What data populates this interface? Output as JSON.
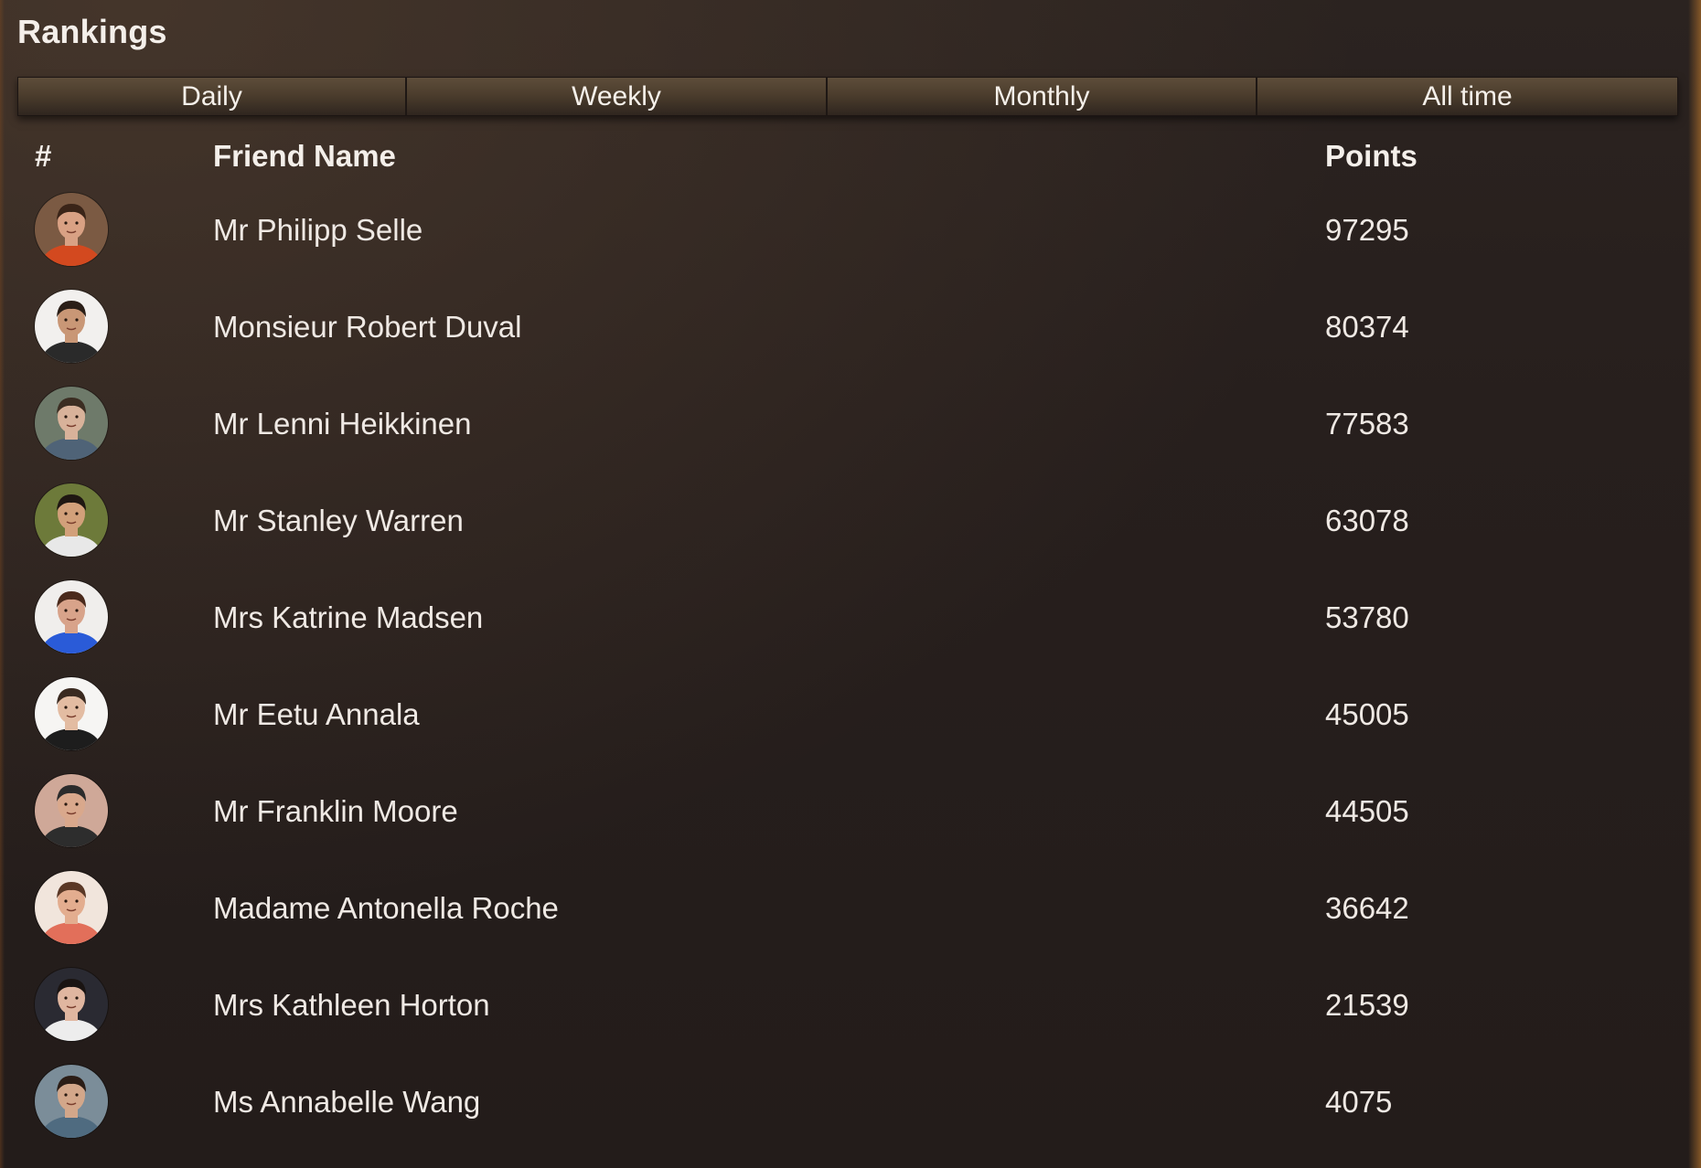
{
  "page": {
    "title": "Rankings"
  },
  "tabs": [
    {
      "label": "Daily"
    },
    {
      "label": "Weekly"
    },
    {
      "label": "Monthly"
    },
    {
      "label": "All time"
    }
  ],
  "table": {
    "headers": {
      "rank": "#",
      "name": "Friend Name",
      "points": "Points"
    },
    "rows": [
      {
        "name": "Mr Philipp Selle",
        "points": "97295",
        "avatar": "avatar-photo-man-orange-shirt",
        "colors": {
          "bg": "#7b5a43",
          "skin": "#d9a184",
          "hair": "#3a2418",
          "shirt": "#d3491f"
        }
      },
      {
        "name": "Monsieur Robert Duval",
        "points": "80374",
        "avatar": "avatar-photo-man-beard",
        "colors": {
          "bg": "#f2f0ee",
          "skin": "#c99776",
          "hair": "#2a1e17",
          "shirt": "#2a2a2a"
        }
      },
      {
        "name": "Mr Lenni Heikkinen",
        "points": "77583",
        "avatar": "avatar-photo-man-outdoor",
        "colors": {
          "bg": "#6e7a6a",
          "skin": "#d8b29a",
          "hair": "#3b2d22",
          "shirt": "#4f6377"
        }
      },
      {
        "name": "Mr Stanley Warren",
        "points": "63078",
        "avatar": "avatar-photo-man-striped-shirt",
        "colors": {
          "bg": "#6d7a3a",
          "skin": "#d2a07a",
          "hair": "#1f1712",
          "shirt": "#e8e8e8"
        }
      },
      {
        "name": "Mrs Katrine Madsen",
        "points": "53780",
        "avatar": "avatar-photo-woman-blue-top",
        "colors": {
          "bg": "#f0eeec",
          "skin": "#d8a38a",
          "hair": "#4a2a1c",
          "shirt": "#2a5bd8"
        }
      },
      {
        "name": "Mr Eetu Annala",
        "points": "45005",
        "avatar": "avatar-photo-man-white-background",
        "colors": {
          "bg": "#f6f5f3",
          "skin": "#e3bca2",
          "hair": "#3a2a20",
          "shirt": "#1d1d1d"
        }
      },
      {
        "name": "Mr Franklin Moore",
        "points": "44505",
        "avatar": "avatar-photo-man-hat",
        "colors": {
          "bg": "#cfa898",
          "skin": "#d9a88c",
          "hair": "#2b2b2b",
          "shirt": "#2d2d2d"
        }
      },
      {
        "name": "Madame Antonella Roche",
        "points": "36642",
        "avatar": "avatar-photo-woman-smiling",
        "colors": {
          "bg": "#f1e5dc",
          "skin": "#e3ad8f",
          "hair": "#5a3826",
          "shirt": "#e26f5a"
        }
      },
      {
        "name": "Mrs Kathleen Horton",
        "points": "21539",
        "avatar": "avatar-photo-woman-dark-hair",
        "colors": {
          "bg": "#2a2a32",
          "skin": "#e0b6a0",
          "hair": "#1a1412",
          "shirt": "#ededed"
        }
      },
      {
        "name": "Ms Annabelle Wang",
        "points": "4075",
        "avatar": "avatar-photo-woman-outdoor",
        "colors": {
          "bg": "#7b8d99",
          "skin": "#d3a78a",
          "hair": "#2b1d16",
          "shirt": "#4f6b80"
        }
      }
    ]
  }
}
